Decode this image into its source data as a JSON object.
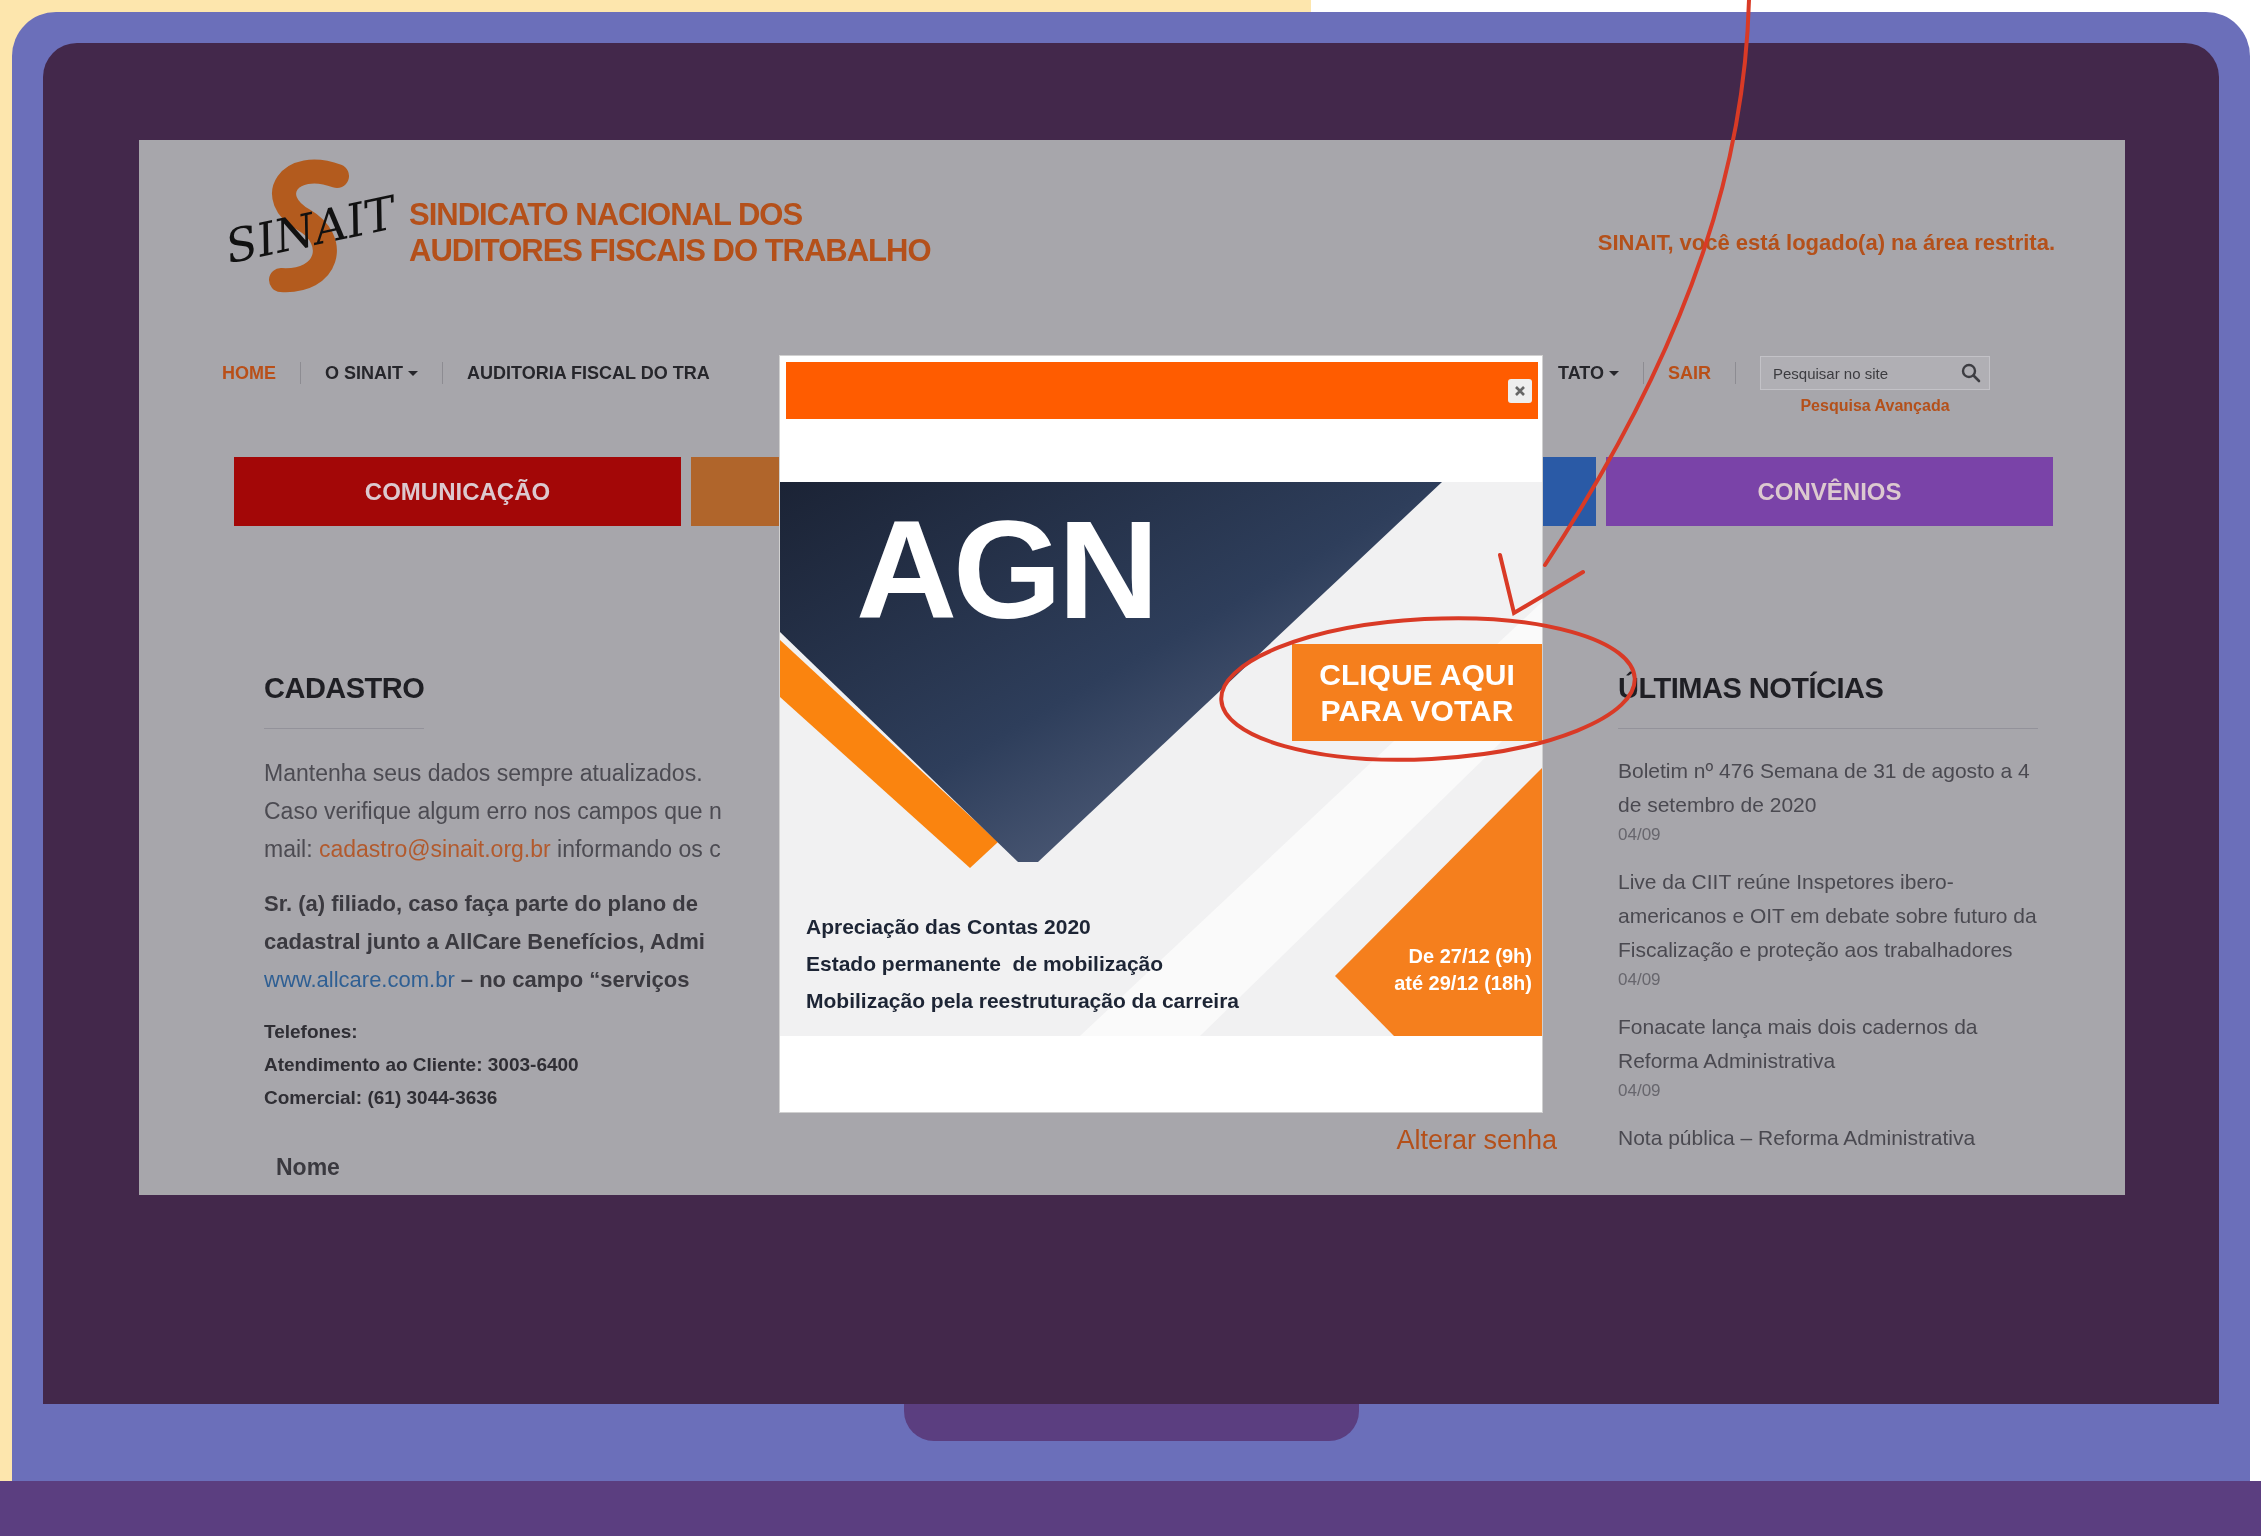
{
  "header": {
    "logo_text": "SINAIT",
    "title_lines": [
      "SINDICATO NACIONAL DOS",
      "AUDITORES FISCAIS DO TRABALHO"
    ],
    "login_notice": "SINAIT, você está logado(a) na área restrita."
  },
  "nav": {
    "left_items": [
      {
        "label": "HOME",
        "accent": true,
        "dropdown": false
      },
      {
        "label": "O SINAIT",
        "accent": false,
        "dropdown": true
      },
      {
        "label": "AUDITORIA FISCAL DO TRA",
        "accent": false,
        "dropdown": false
      }
    ],
    "right_items": [
      {
        "label": "TATO",
        "accent": false,
        "dropdown": true
      },
      {
        "label": "SAIR",
        "accent": true,
        "dropdown": false
      }
    ],
    "search": {
      "placeholder": "Pesquisar no site"
    },
    "advanced_search": "Pesquisa Avançada"
  },
  "category_tabs": [
    {
      "label": "COMUNICAÇÃO",
      "color": "#a30707"
    },
    {
      "color": "#b0652b"
    },
    {
      "color": "#2a5aa6"
    },
    {
      "label": "CONVÊNIOS",
      "color": "#7a43a8"
    }
  ],
  "cadastro": {
    "heading": "CADASTRO",
    "intro_lines": [
      {
        "text": "Mantenha seus dados sempre atualizados."
      },
      {
        "text": "Caso verifique algum erro nos campos que n"
      },
      {
        "before": "mail: ",
        "link": "cadastro@sinait.org.br",
        "after": " informando os c"
      }
    ],
    "notice_lines": [
      {
        "text": "Sr. (a) filiado, caso faça parte do plano de"
      },
      {
        "text": "cadastral junto a AllCare Benefícios, Admi"
      },
      {
        "link": "www.allcare.com.br",
        "after": " – no campo “serviços"
      }
    ],
    "phones": [
      "Telefones:",
      "Atendimento ao Cliente: 3003-6400",
      "Comercial: (61) 3044-3636"
    ],
    "form_label": "Nome"
  },
  "change_password": "Alterar senha",
  "news": {
    "heading": "ÚLTIMAS NOTÍCIAS",
    "items": [
      {
        "title": "Boletim nº 476 Semana de 31 de agosto a 4 de setembro de 2020",
        "date": "04/09"
      },
      {
        "title": "Live da CIIT reúne Inspetores ibero-americanos e OIT em debate sobre futuro da Fiscalização e proteção aos trabalhadores",
        "date": "04/09"
      },
      {
        "title": "Fonacate lança mais dois cadernos da Reforma Administrativa",
        "date": "04/09"
      },
      {
        "title": "Nota pública – Reforma Administrativa"
      }
    ]
  },
  "modal": {
    "banner": {
      "title": "AGN",
      "cta_lines": [
        "CLIQUE AQUI",
        "PARA VOTAR"
      ],
      "topics": [
        "Apreciação das Contas 2020",
        "Estado permanente  de mobilização",
        "Mobilização pela reestruturação da carreira"
      ],
      "dates": [
        "De 27/12 (9h)",
        "até 29/12 (18h)"
      ]
    }
  }
}
